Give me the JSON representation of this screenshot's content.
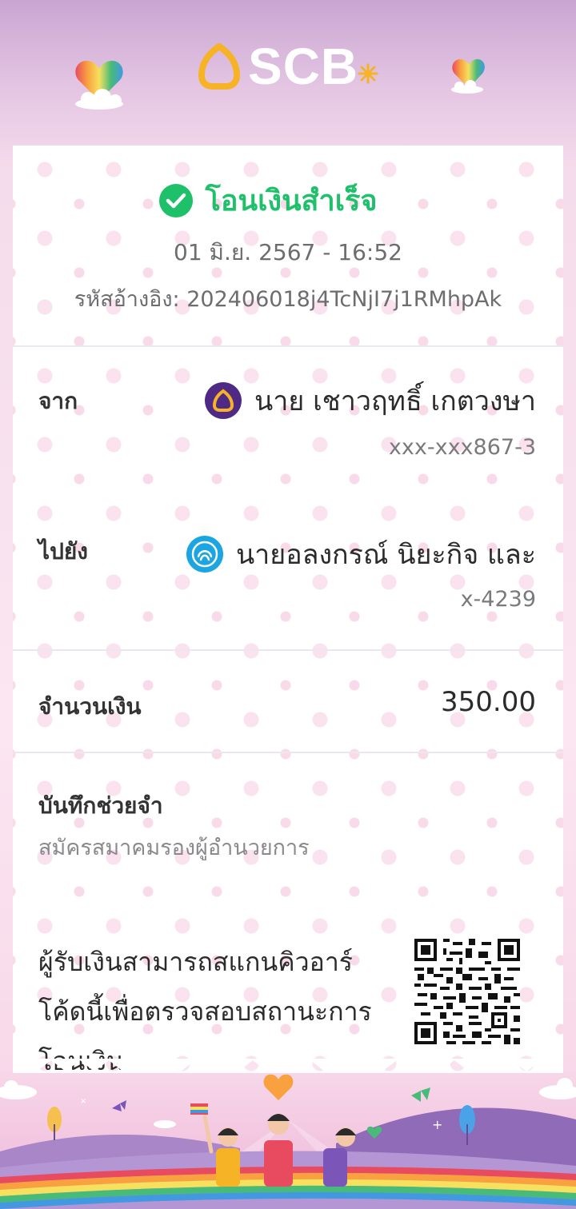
{
  "header": {
    "brand": "SCB"
  },
  "receipt": {
    "status": "โอนเงินสำเร็จ",
    "datetime": "01 มิ.ย. 2567 - 16:52",
    "reference": "รหัสอ้างอิง: 202406018j4TcNjI7j1RMhpAk",
    "from": {
      "label": "จาก",
      "name": "นาย เชาวฤทธิ์ เกตวงษา",
      "account": "xxx-xxx867-3",
      "bank_color": "#4e2a84"
    },
    "to": {
      "label": "ไปยัง",
      "name": "นายอลงกรณ์ นิยะกิจ และ",
      "account": "x-4239",
      "bank_color": "#1ba5e1"
    },
    "amount": {
      "label": "จำนวนเงิน",
      "value": "350.00"
    },
    "memo": {
      "label": "บันทึกช่วยจำ",
      "value": "สมัครสมาคมรองผู้อำนวยการ"
    },
    "qr_note": "ผู้รับเงินสามารถสแกนคิวอาร์โค้ดนี้เพื่อตรวจสอบสถานะการโอนเงิน"
  },
  "colors": {
    "success": "#1fc06a",
    "brand_gold": "#f5b325"
  }
}
